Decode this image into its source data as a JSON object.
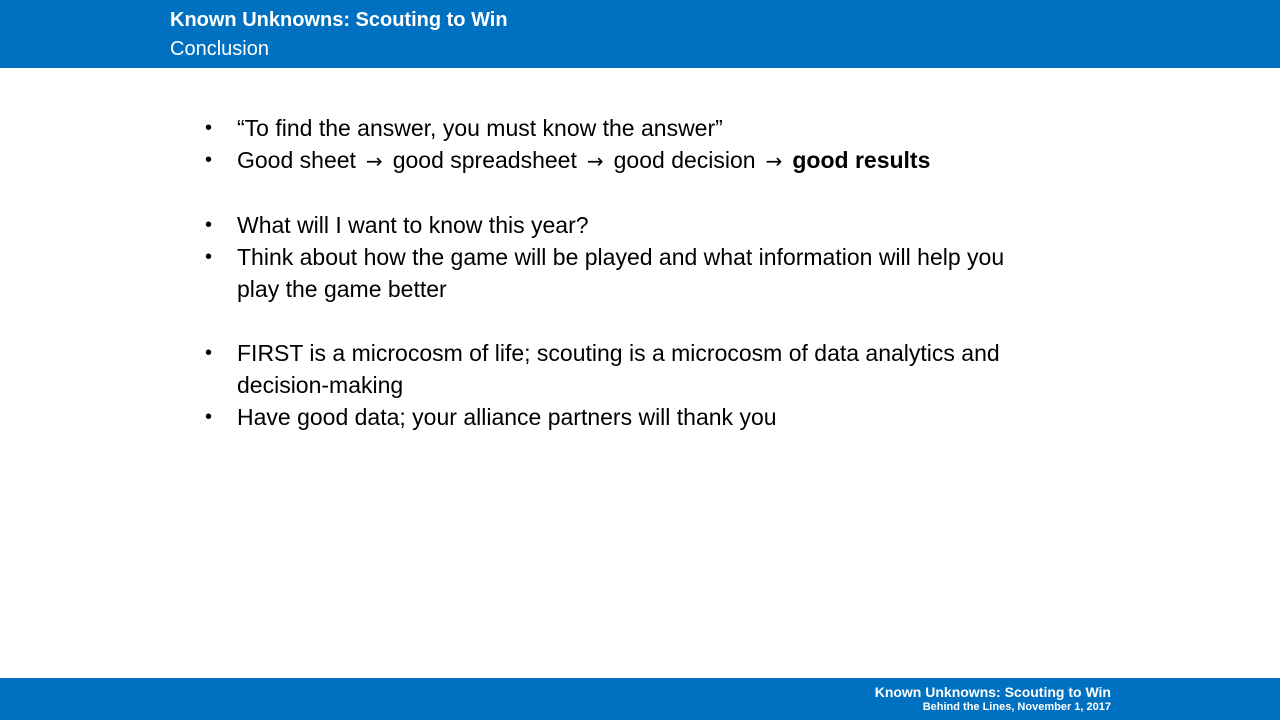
{
  "header": {
    "title": "Known Unknowns: Scouting to Win",
    "subtitle": "Conclusion"
  },
  "bullet_glyph": "•",
  "arrow_icon": "arrow-right-icon",
  "arrow_glyph": "→",
  "bullets": [
    "“To find the answer, you must know the answer”",
    {
      "parts": [
        "Good sheet",
        "good spreadsheet",
        "good decision",
        "good results"
      ]
    },
    "What will I want to know this year?",
    "Think about how the game will be played and what information will help you play the game better",
    "FIRST is a microcosm of life; scouting is a microcosm of data analytics and decision-making",
    "Have good data; your alliance partners will thank you"
  ],
  "footer": {
    "line1": "Known Unknowns: Scouting to Win",
    "line2": "Behind the Lines, November 1, 2017"
  },
  "colors": {
    "brand_blue": "#0070c0",
    "text": "#000000",
    "header_text": "#ffffff"
  }
}
